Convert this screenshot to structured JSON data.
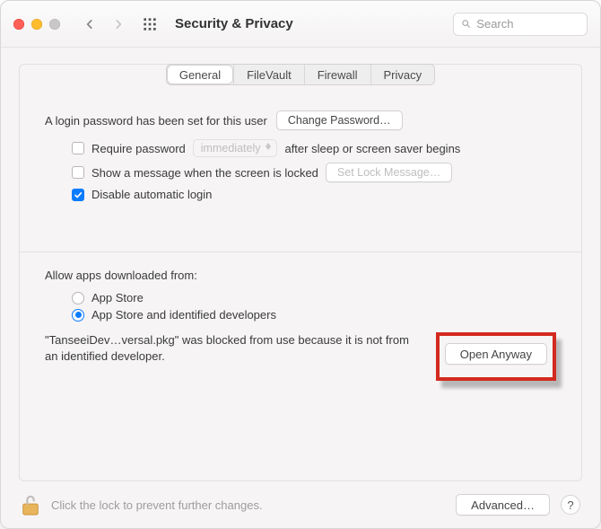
{
  "toolbar": {
    "title": "Security & Privacy",
    "search_placeholder": "Search"
  },
  "tabs": {
    "general": "General",
    "filevault": "FileVault",
    "firewall": "Firewall",
    "privacy": "Privacy"
  },
  "login": {
    "password_set_text": "A login password has been set for this user",
    "change_password_btn": "Change Password…",
    "require_password_label": "Require password",
    "require_password_delay": "immediately",
    "require_password_after": "after sleep or screen saver begins",
    "show_message_label": "Show a message when the screen is locked",
    "set_lock_message_btn": "Set Lock Message…",
    "disable_auto_login_label": "Disable automatic login"
  },
  "gatekeeper": {
    "heading": "Allow apps downloaded from:",
    "opt_app_store": "App Store",
    "opt_identified": "App Store and identified developers",
    "blocked_text": "\"TanseeiDev…versal.pkg\" was blocked from use because it is not from an identified developer.",
    "open_anyway_btn": "Open Anyway"
  },
  "footer": {
    "lock_text": "Click the lock to prevent further changes.",
    "advanced_btn": "Advanced…",
    "help_label": "?"
  }
}
